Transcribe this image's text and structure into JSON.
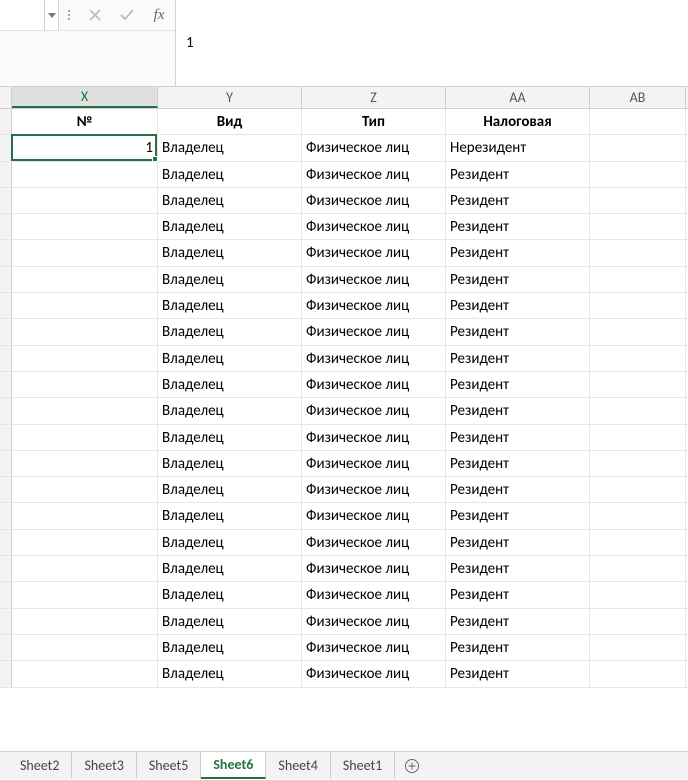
{
  "formula_bar": {
    "name_box": "",
    "value": "1",
    "fx_label": "fx"
  },
  "columns": [
    "X",
    "Y",
    "Z",
    "AA",
    "AB"
  ],
  "active_column_index": 0,
  "header_row": {
    "x": "№",
    "y": "Вид",
    "z": "Тип",
    "aa": "Налоговая",
    "ab": ""
  },
  "selected_cell": {
    "row": 1,
    "col": 0,
    "value": "1"
  },
  "data_rows": [
    {
      "x": "1",
      "y": "Владелец",
      "z": "Физическое лиц",
      "aa": "Нерезидент"
    },
    {
      "x": "",
      "y": "Владелец",
      "z": "Физическое лиц",
      "aa": "Резидент"
    },
    {
      "x": "",
      "y": "Владелец",
      "z": "Физическое лиц",
      "aa": "Резидент"
    },
    {
      "x": "",
      "y": "Владелец",
      "z": "Физическое лиц",
      "aa": "Резидент"
    },
    {
      "x": "",
      "y": "Владелец",
      "z": "Физическое лиц",
      "aa": "Резидент"
    },
    {
      "x": "",
      "y": "Владелец",
      "z": "Физическое лиц",
      "aa": "Резидент"
    },
    {
      "x": "",
      "y": "Владелец",
      "z": "Физическое лиц",
      "aa": "Резидент"
    },
    {
      "x": "",
      "y": "Владелец",
      "z": "Физическое лиц",
      "aa": "Резидент"
    },
    {
      "x": "",
      "y": "Владелец",
      "z": "Физическое лиц",
      "aa": "Резидент"
    },
    {
      "x": "",
      "y": "Владелец",
      "z": "Физическое лиц",
      "aa": "Резидент"
    },
    {
      "x": "",
      "y": "Владелец",
      "z": "Физическое лиц",
      "aa": "Резидент"
    },
    {
      "x": "",
      "y": "Владелец",
      "z": "Физическое лиц",
      "aa": "Резидент"
    },
    {
      "x": "",
      "y": "Владелец",
      "z": "Физическое лиц",
      "aa": "Резидент"
    },
    {
      "x": "",
      "y": "Владелец",
      "z": "Физическое лиц",
      "aa": "Резидент"
    },
    {
      "x": "",
      "y": "Владелец",
      "z": "Физическое лиц",
      "aa": "Резидент"
    },
    {
      "x": "",
      "y": "Владелец",
      "z": "Физическое лиц",
      "aa": "Резидент"
    },
    {
      "x": "",
      "y": "Владелец",
      "z": "Физическое лиц",
      "aa": "Резидент"
    },
    {
      "x": "",
      "y": "Владелец",
      "z": "Физическое лиц",
      "aa": "Резидент"
    },
    {
      "x": "",
      "y": "Владелец",
      "z": "Физическое лиц",
      "aa": "Резидент"
    },
    {
      "x": "",
      "y": "Владелец",
      "z": "Физическое лиц",
      "aa": "Резидент"
    },
    {
      "x": "",
      "y": "Владелец",
      "z": "Физическое лиц",
      "aa": "Резидент"
    }
  ],
  "sheet_tabs": [
    {
      "label": "Sheet2",
      "active": false
    },
    {
      "label": "Sheet3",
      "active": false
    },
    {
      "label": "Sheet5",
      "active": false
    },
    {
      "label": "Sheet6",
      "active": true
    },
    {
      "label": "Sheet4",
      "active": false
    },
    {
      "label": "Sheet1",
      "active": false
    }
  ]
}
